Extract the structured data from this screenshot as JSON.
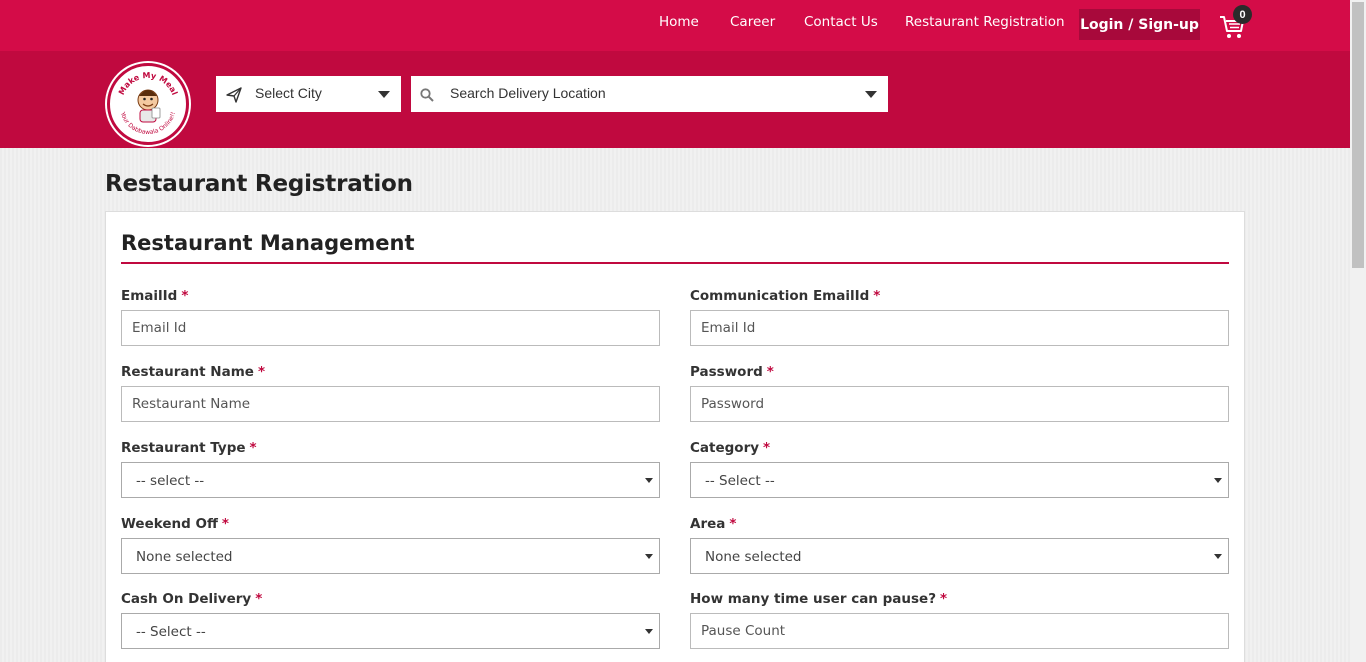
{
  "nav": {
    "home": "Home",
    "career": "Career",
    "contact": "Contact Us",
    "restaurant_registration": "Restaurant Registration",
    "login": "Login / Sign-up",
    "cart_count": "0"
  },
  "search": {
    "city": "Select City",
    "location": "Search Delivery Location"
  },
  "logo": {
    "top_text": "Make My Meal",
    "bottom_text": "Your Dabbawala Online!!"
  },
  "page": {
    "title": "Restaurant Registration",
    "section": "Restaurant Management"
  },
  "form": {
    "email": {
      "label": "EmailId",
      "placeholder": "Email Id"
    },
    "comm_email": {
      "label": "Communication EmailId",
      "placeholder": "Email Id"
    },
    "restaurant_name": {
      "label": "Restaurant Name",
      "placeholder": "Restaurant Name"
    },
    "password": {
      "label": "Password",
      "placeholder": "Password"
    },
    "restaurant_type": {
      "label": "Restaurant Type",
      "value": "-- select --"
    },
    "category": {
      "label": "Category",
      "value": "-- Select --"
    },
    "weekend_off": {
      "label": "Weekend Off",
      "value": "None selected"
    },
    "area": {
      "label": "Area",
      "value": "None selected"
    },
    "cash_on_delivery": {
      "label": "Cash On Delivery",
      "value": "-- Select --"
    },
    "pause_count": {
      "label": "How many time user can pause?",
      "placeholder": "Pause Count"
    },
    "required_mark": "*"
  },
  "colors": {
    "brand": "#d40c48",
    "brand_dark": "#c0093f",
    "button": "#a8093b"
  }
}
